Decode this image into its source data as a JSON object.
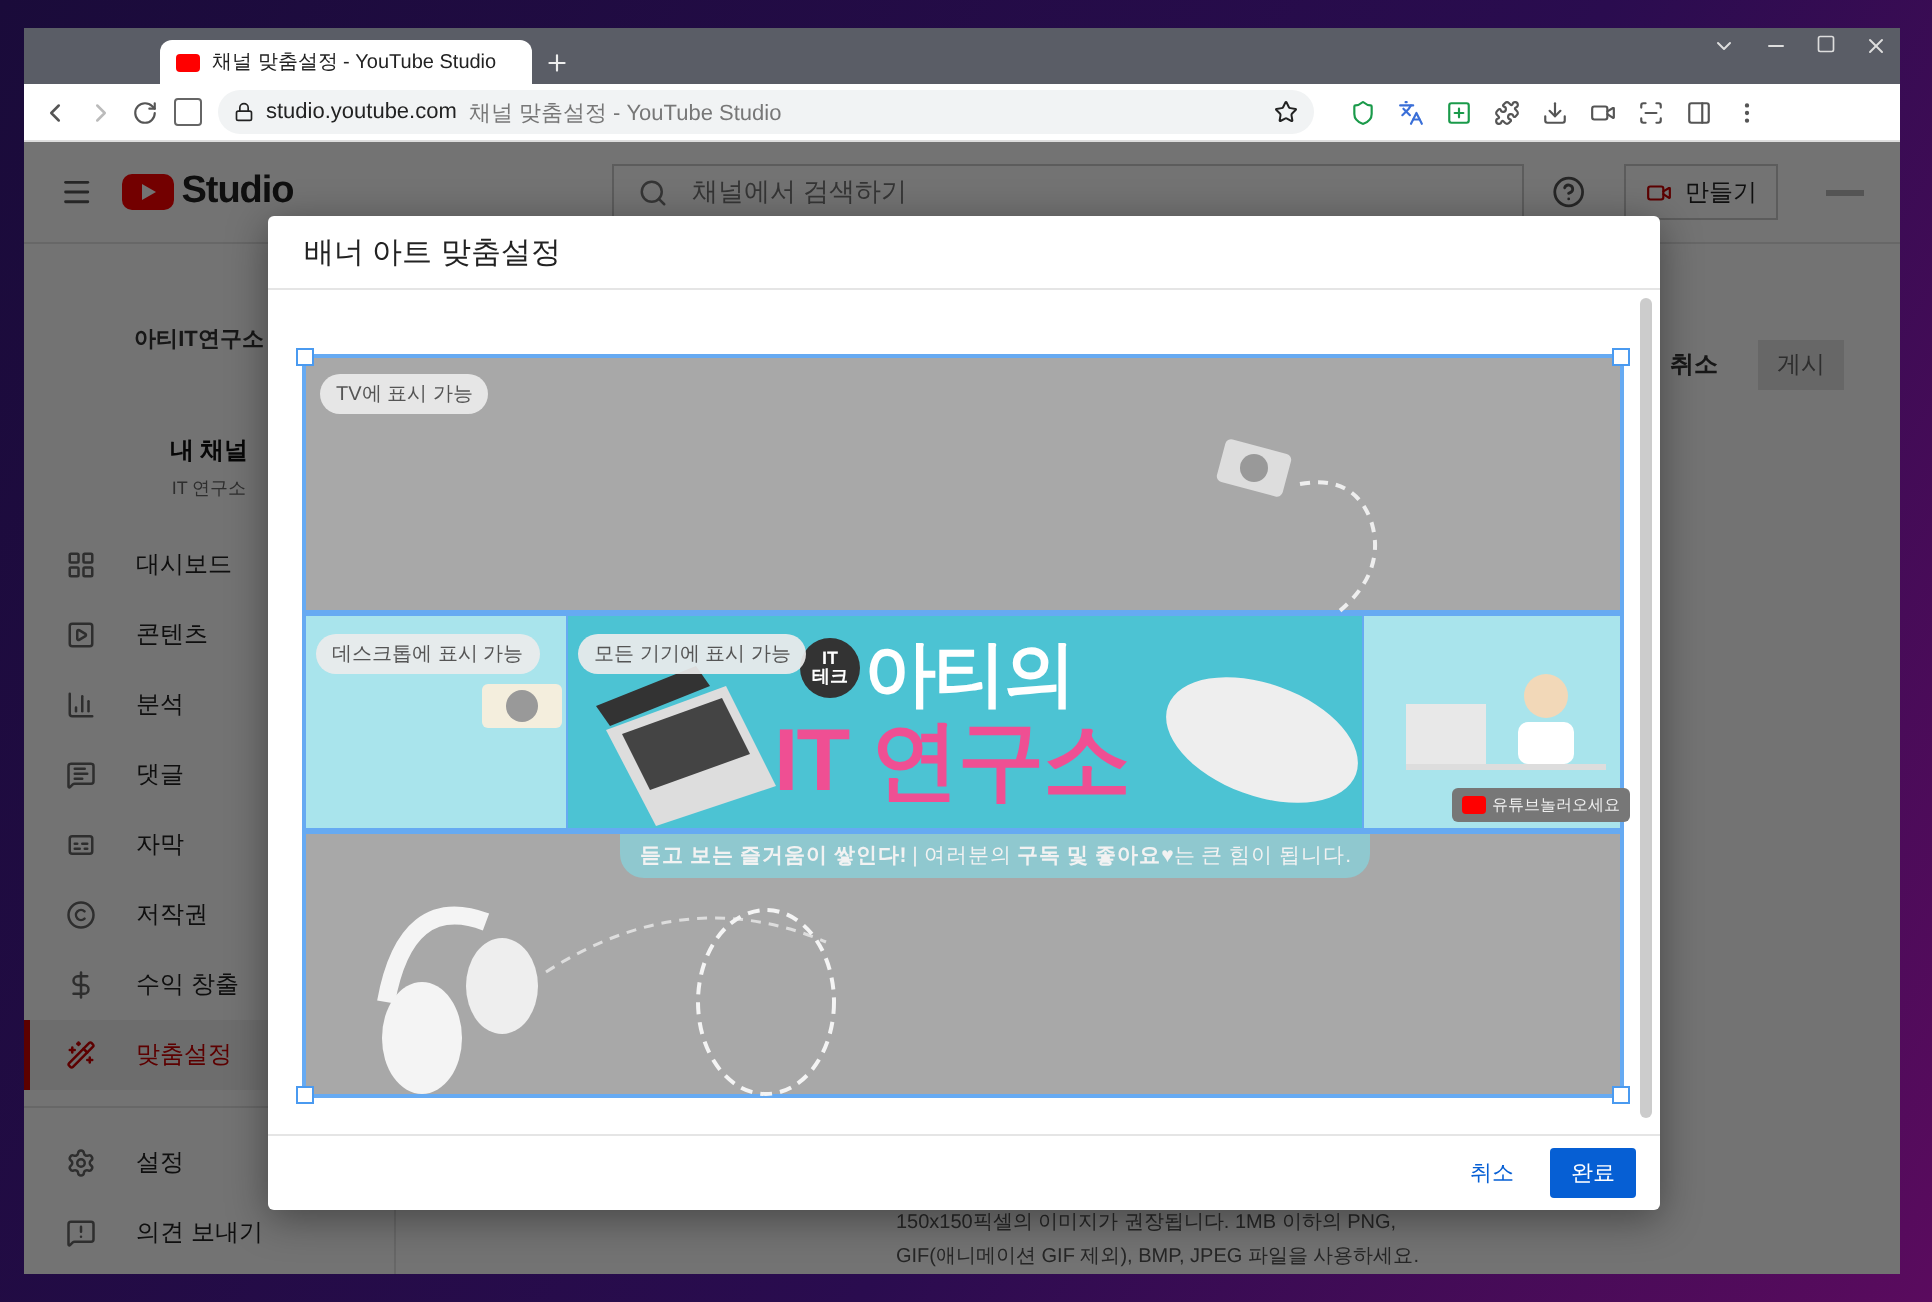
{
  "browser": {
    "tab_title": "채널 맞춤설정 - YouTube Studio",
    "url_host": "studio.youtube.com",
    "url_title": "채널 맞춤설정 - YouTube Studio"
  },
  "header": {
    "logo_text": "Studio",
    "search_placeholder": "채널에서 검색하기",
    "create_button": "만들기"
  },
  "sidebar": {
    "channel_logo": "아티IT연구소",
    "channel_title": "내 채널",
    "channel_name": "IT 연구소",
    "items": [
      {
        "label": "대시보드",
        "selected": false
      },
      {
        "label": "콘텐츠",
        "selected": false
      },
      {
        "label": "분석",
        "selected": false
      },
      {
        "label": "댓글",
        "selected": false
      },
      {
        "label": "자막",
        "selected": false
      },
      {
        "label": "저작권",
        "selected": false
      },
      {
        "label": "수익 창출",
        "selected": false
      },
      {
        "label": "맞춤설정",
        "selected": true
      }
    ],
    "footer_items": [
      {
        "label": "설정"
      },
      {
        "label": "의견 보내기"
      }
    ]
  },
  "page_actions": {
    "cancel": "취소",
    "publish": {
      "label": "게시",
      "disabled": true
    }
  },
  "help_text": [
    "150x150픽셀의 이미지가 권장됩니다. 1MB 이하의 PNG,",
    "GIF(애니메이션 GIF 제외), BMP, JPEG 파일을 사용하세요."
  ],
  "dialog": {
    "title": "배너 아트 맞춤설정",
    "zones": [
      {
        "label": "TV에 표시 가능"
      },
      {
        "label": "데스크톱에 표시 가능"
      },
      {
        "label": "모든 기기에 표시 가능"
      }
    ],
    "banner": {
      "badge_top": "IT",
      "badge_bottom": "테크",
      "title_top": "아티의",
      "title_bottom": "IT 연구소",
      "slogan": "**듣고 보는 즐거움이 쌓인다!** | 여러분의 **구독 및 좋아요♥**는 큰 힘이 됩니다.",
      "youtube_badge": "유튜브놀러오세요"
    },
    "buttons": [
      {
        "label": "취소",
        "kind": "text"
      },
      {
        "label": "완료",
        "kind": "primary"
      }
    ]
  }
}
